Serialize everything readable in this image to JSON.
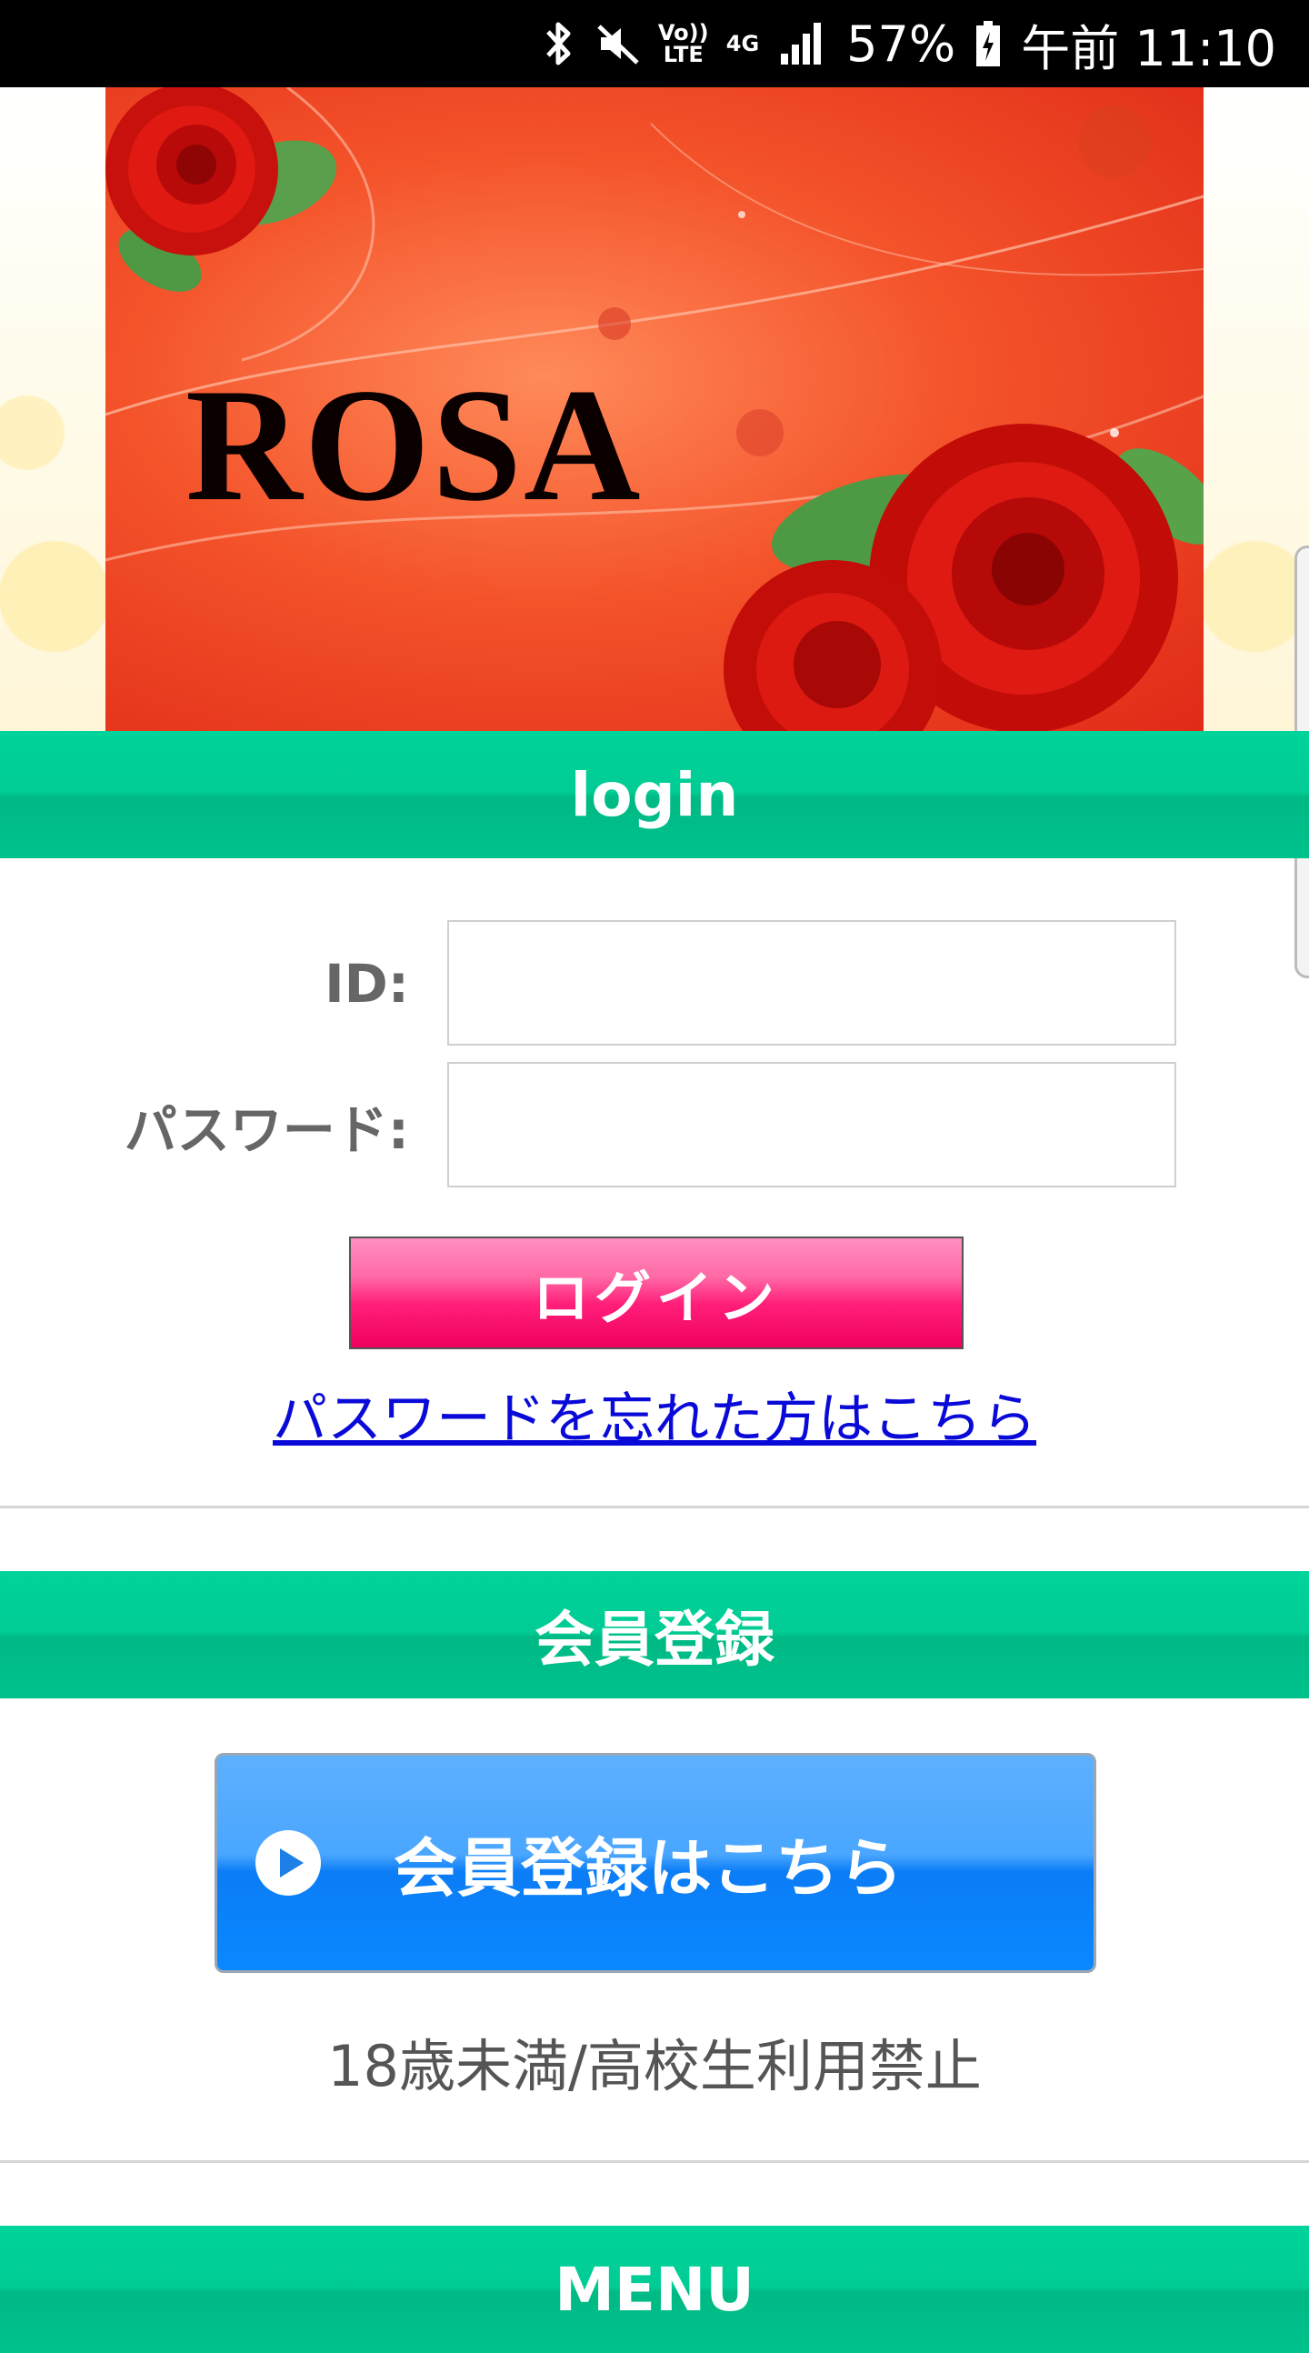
{
  "status_bar": {
    "battery_percent": "57%",
    "time": "午前 11:10",
    "volte_label": "Vo)) LTE",
    "network_label": "4G",
    "icons": [
      "bluetooth-icon",
      "mute-icon",
      "volte-icon",
      "4g-icon",
      "signal-icon",
      "battery-icon"
    ]
  },
  "banner": {
    "title": "ROSA"
  },
  "login_section": {
    "header": "login",
    "id_label": "ID:",
    "password_label": "パスワード:",
    "id_value": "",
    "password_value": "",
    "login_button": "ログイン",
    "forgot_link": "パスワードを忘れた方はこちら"
  },
  "register_section": {
    "header": "会員登録",
    "register_button": "会員登録はこちら",
    "age_notice": "18歳未満/高校生利用禁止"
  },
  "menu_section": {
    "header": "MENU"
  },
  "colors": {
    "section_header": "#00cc94",
    "login_button": "#ff1f7a",
    "register_button": "#0b7df6",
    "link": "#0a0ad8"
  }
}
